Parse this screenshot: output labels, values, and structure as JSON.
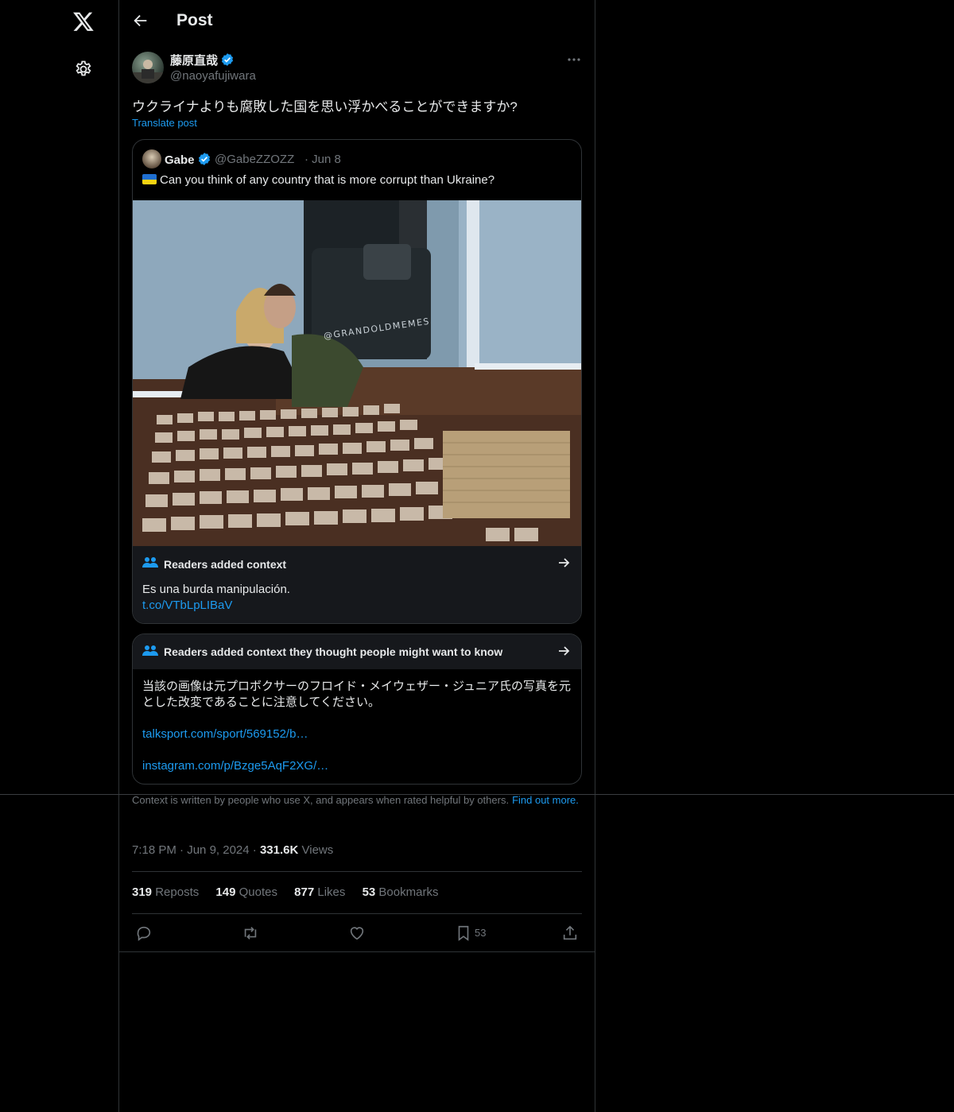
{
  "topbar": {
    "title": "Post"
  },
  "post": {
    "author_name": "藤原直哉",
    "author_handle": "@naoyafujiwara",
    "text": "ウクライナよりも腐敗した国を思い浮かべることができますか?",
    "translate_label": "Translate post"
  },
  "quote": {
    "name": "Gabe",
    "handle": "@GabeZZOZZ",
    "date": "Jun 8",
    "text": "Can you think of any country that is more corrupt than Ukraine?",
    "watermark": "@GRANDOLDMEMES",
    "note": {
      "title": "Readers added context",
      "body": "Es una burda manipulación.",
      "link": "t.co/VTbLpLIBaV"
    }
  },
  "note2": {
    "title": "Readers added context they thought people might want to know",
    "body": "当該の画像は元プロボクサーのフロイド・メイウェザー・ジュニア氏の写真を元とした改変であることに注意してください。",
    "link1": "talksport.com/sport/569152/b…",
    "link2": "instagram.com/p/Bzge5AqF2XG/…"
  },
  "disclaimer": {
    "text": "Context is written by people who use X, and appears when rated helpful by others.",
    "link": "Find out more."
  },
  "meta": {
    "time": "7:18 PM",
    "date": "Jun 9, 2024",
    "views_count": "331.6K",
    "views_label": "Views"
  },
  "stats": {
    "reposts_count": "319",
    "reposts_label": "Reposts",
    "quotes_count": "149",
    "quotes_label": "Quotes",
    "likes_count": "877",
    "likes_label": "Likes",
    "bookmarks_count": "53",
    "bookmarks_label": "Bookmarks"
  },
  "actions": {
    "bookmark_count": "53"
  },
  "colors": {
    "accent": "#1d9bf0",
    "muted": "#71767b",
    "border": "#2f3336",
    "note_bg": "#16181c"
  },
  "icons": [
    "x-logo-icon",
    "gear-icon",
    "back-arrow-icon",
    "verified-icon",
    "more-icon",
    "people-icon",
    "arrow-right-icon",
    "reply-icon",
    "repost-icon",
    "like-icon",
    "bookmark-icon",
    "share-icon"
  ]
}
